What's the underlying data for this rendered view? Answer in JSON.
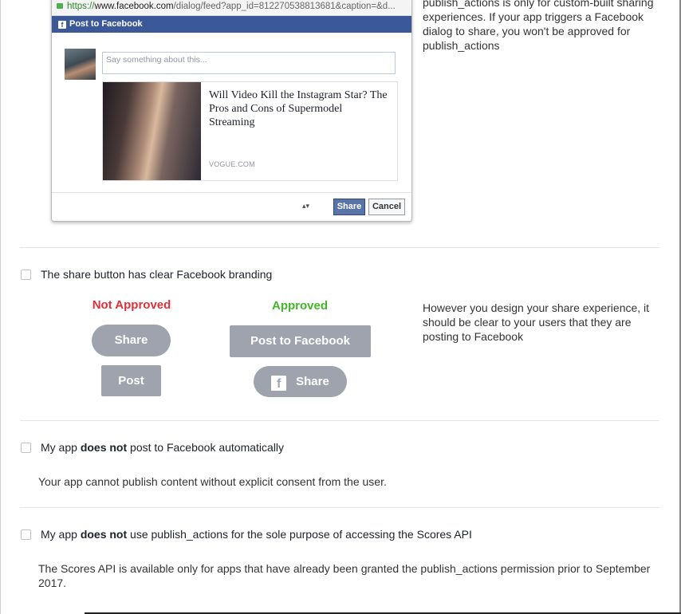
{
  "dialog": {
    "url_https": "https://",
    "url_host": "www.facebook.com",
    "url_rest": "/dialog/feed?app_id=812270538813681&caption=&d...",
    "header_title": "Post to Facebook",
    "compose_placeholder": "Say something about this...",
    "link_title": "Will Video Kill the Instagram Star? The Pros and Cons of Supermodel Streaming",
    "link_domain": "VOGUE.COM",
    "audience_icon": "▴▾",
    "share_label": "Share",
    "cancel_label": "Cancel"
  },
  "top_note": "publish_actions is only for custom-built sharing experiences. If your app triggers a Facebook dialog to share, you won't be approved for publish_actions",
  "branding": {
    "check_label": "The share button has clear Facebook branding",
    "not_approved_heading": "Not Approved",
    "approved_heading": "Approved",
    "bad_share_label": "Share",
    "bad_post_label": "Post",
    "good_post_label": "Post to Facebook",
    "good_share_label": "Share",
    "note": "However you design your share experience, it should be clear to your users that they are posting to Facebook",
    "colors": {
      "not_approved": "#e02f38",
      "approved": "#42b72a",
      "button": "#9ea3ad"
    }
  },
  "automatic": {
    "prefix": "My app ",
    "bold": "does not",
    "suffix": " post to Facebook automatically",
    "description": "Your app cannot publish content without explicit consent from the user."
  },
  "scores": {
    "prefix": "My app ",
    "bold": "does not",
    "suffix": " use publish_actions for the sole purpose of accessing the Scores API",
    "description": "The Scores API is available only for apps that have already been granted the publish_actions permission prior to September 2017."
  }
}
